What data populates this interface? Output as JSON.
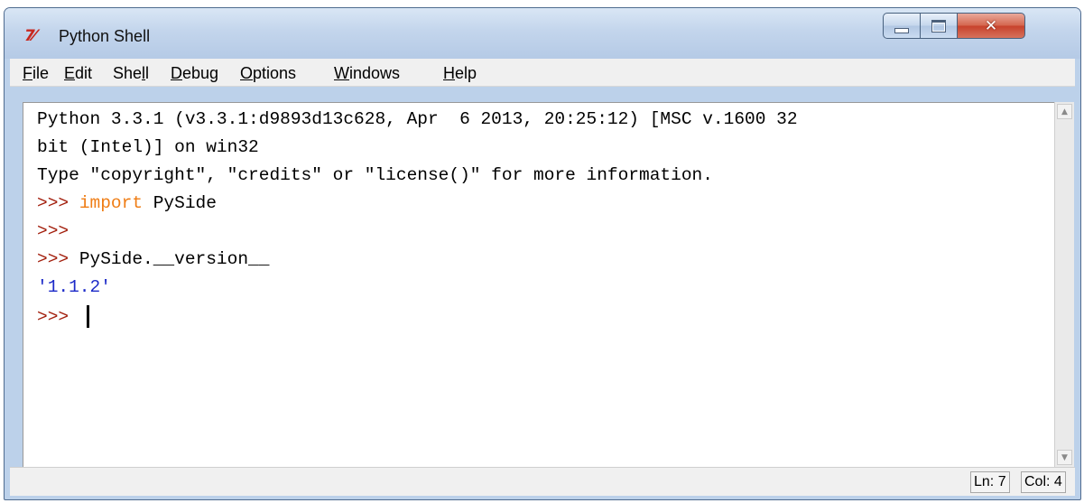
{
  "window": {
    "title": "Python Shell",
    "app_icon": "tk-feather-icon",
    "controls": {
      "minimize": "minimize-icon",
      "maximize": "maximize-icon",
      "close": "close-icon"
    }
  },
  "menubar": {
    "items": [
      {
        "label_pre": "",
        "label_u": "F",
        "label_post": "ile"
      },
      {
        "label_pre": "",
        "label_u": "E",
        "label_post": "dit"
      },
      {
        "label_pre": "She",
        "label_u": "l",
        "label_post": "l"
      },
      {
        "label_pre": "",
        "label_u": "D",
        "label_post": "ebug"
      },
      {
        "label_pre": "",
        "label_u": "O",
        "label_post": "ptions"
      },
      {
        "label_pre": "",
        "label_u": "W",
        "label_post": "indows"
      },
      {
        "label_pre": "",
        "label_u": "H",
        "label_post": "elp"
      }
    ]
  },
  "shell": {
    "banner_line1": "Python 3.3.1 (v3.3.1:d9893d13c628, Apr  6 2013, 20:25:12) [MSC v.1600 32",
    "banner_line2": "bit (Intel)] on win32",
    "banner_line3": "Type \"copyright\", \"credits\" or \"license()\" for more information.",
    "prompt": ">>> ",
    "cmd1_keyword": "import",
    "cmd1_rest": " PySide",
    "cmd3": "PySide.__version__",
    "output": "'1.1.2'"
  },
  "statusbar": {
    "line": "Ln: 7",
    "col": "Col: 4"
  },
  "colors": {
    "prompt": "#a3200e",
    "keyword": "#ef7d15",
    "string_output": "#1c2ac8"
  }
}
